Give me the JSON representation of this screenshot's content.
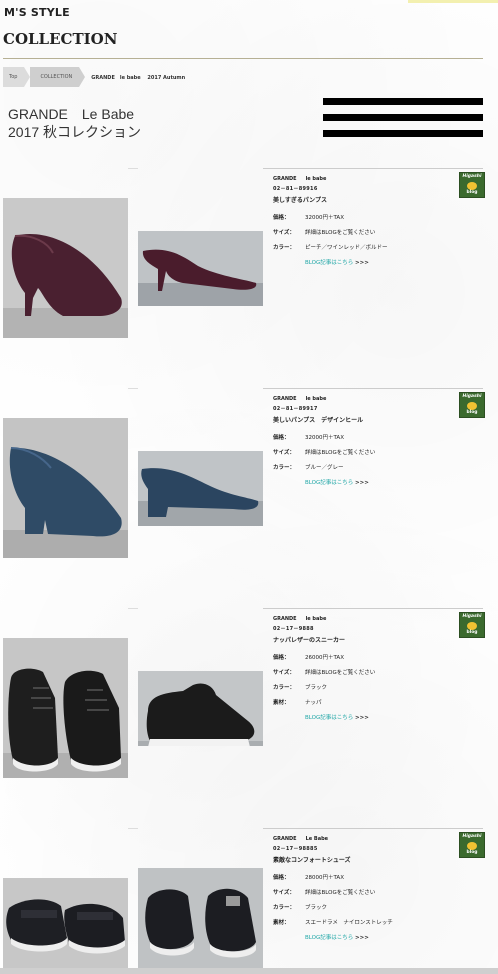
{
  "site": {
    "logo": "M'S STYLE",
    "section_title": "COLLECTION"
  },
  "breadcrumb": [
    "Top",
    "COLLECTION"
  ],
  "breadcrumb_current": "GRANDE　le babe　 2017 Autumn",
  "heading": {
    "line1": "GRANDE　Le Babe",
    "line2": "2017 秋コレクション"
  },
  "labels": {
    "price": "価格：",
    "size": "サイズ：",
    "color": "カラー：",
    "material": "素材：",
    "blog_link": "BLOG記事はこちら",
    "blog_arrow": ">>>"
  },
  "blog_badge": {
    "line1": "Higashi",
    "line2": "blog"
  },
  "products": [
    {
      "brand": "GRANDE",
      "brand2": "le babe",
      "code": "02－81－89916",
      "name": "美しすぎるパンプス",
      "price": "32000円＋TAX",
      "size": "詳細はBLOGをご覧ください",
      "color": "ピーチ／ワインレッド／ボルドー",
      "material": ""
    },
    {
      "brand": "GRANDE",
      "brand2": "le babe",
      "code": "02－81－89917",
      "name": "美しいパンプス　デザインヒール",
      "price": "32000円＋TAX",
      "size": "詳細はBLOGをご覧ください",
      "color": "ブルー／グレー",
      "material": ""
    },
    {
      "brand": "GRANDE",
      "brand2": "le babe",
      "code": "02－17－9888",
      "name": "ナッパレザーのスニーカー",
      "price": "26000円＋TAX",
      "size": "詳細はBLOGをご覧ください",
      "color": "ブラック",
      "material": "ナッパ"
    },
    {
      "brand": "GRANDE",
      "brand2": "Le Babe",
      "code": "02－17－98885",
      "name": "素敵なコンフォートシューズ",
      "price": "28000円＋TAX",
      "size": "詳細はBLOGをご覧ください",
      "color": "ブラック",
      "material": "スエードラメ　ナイロンストレッチ"
    }
  ]
}
